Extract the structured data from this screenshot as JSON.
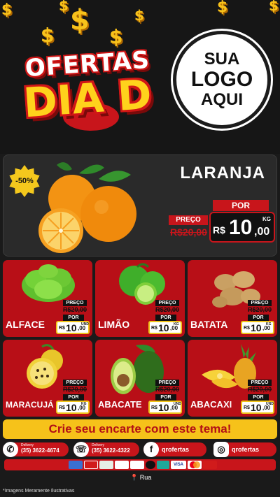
{
  "header": {
    "title_line1": "OFERTAS",
    "title_line2": "DIA D",
    "logo_lines": [
      "SUA",
      "LOGO",
      "AQUI"
    ]
  },
  "hero": {
    "discount_badge": "-50%",
    "product": "LARANJA",
    "old_price_label": "PREÇO",
    "old_price": "R$20,00",
    "new_price_label": "POR",
    "currency": "R$",
    "price_int": "10",
    "price_dec": ",00",
    "unit": "KG"
  },
  "products": [
    {
      "name": "ALFACE",
      "preco_label": "PREÇO",
      "old_price": "R$20,00",
      "por_label": "POR",
      "currency": "R$",
      "price_int": "10",
      "price_dec": ",00",
      "unit": "UND"
    },
    {
      "name": "LIMÃO",
      "preco_label": "PREÇO",
      "old_price": "R$20,00",
      "por_label": "POR",
      "currency": "R$",
      "price_int": "10",
      "price_dec": ",00",
      "unit": "KG"
    },
    {
      "name": "BATATA",
      "preco_label": "PREÇO",
      "old_price": "R$20,00",
      "por_label": "POR",
      "currency": "R$",
      "price_int": "10",
      "price_dec": ",00",
      "unit": "KG"
    },
    {
      "name": "MARACUJÁ",
      "preco_label": "PREÇO",
      "old_price": "R$20,00",
      "por_label": "POR",
      "currency": "R$",
      "price_int": "10",
      "price_dec": ",00",
      "unit": "KG"
    },
    {
      "name": "ABACATE",
      "preco_label": "PREÇO",
      "old_price": "R$20,00",
      "por_label": "POR",
      "currency": "R$",
      "price_int": "10",
      "price_dec": ",00",
      "unit": "UND"
    },
    {
      "name": "ABACAXI",
      "preco_label": "PREÇO",
      "old_price": "R$20,00",
      "por_label": "POR",
      "currency": "R$",
      "price_int": "10",
      "price_dec": ",00",
      "unit": "UND"
    }
  ],
  "cta": "Crie seu encarte com este tema!",
  "contacts": {
    "whatsapp_label": "Delivery",
    "whatsapp_phone": "(35) 3622-4674",
    "phone_label": "Delivery",
    "phone": "(35) 3622-4322",
    "facebook": "qrofertas",
    "instagram": "qrofertas"
  },
  "payments": [
    "VISA"
  ],
  "address": "Rua",
  "footnote": "*Imagens Meramente Ilustrativas",
  "colors": {
    "red": "#c8151b",
    "yellow": "#f6c21a",
    "dark": "#161616"
  }
}
